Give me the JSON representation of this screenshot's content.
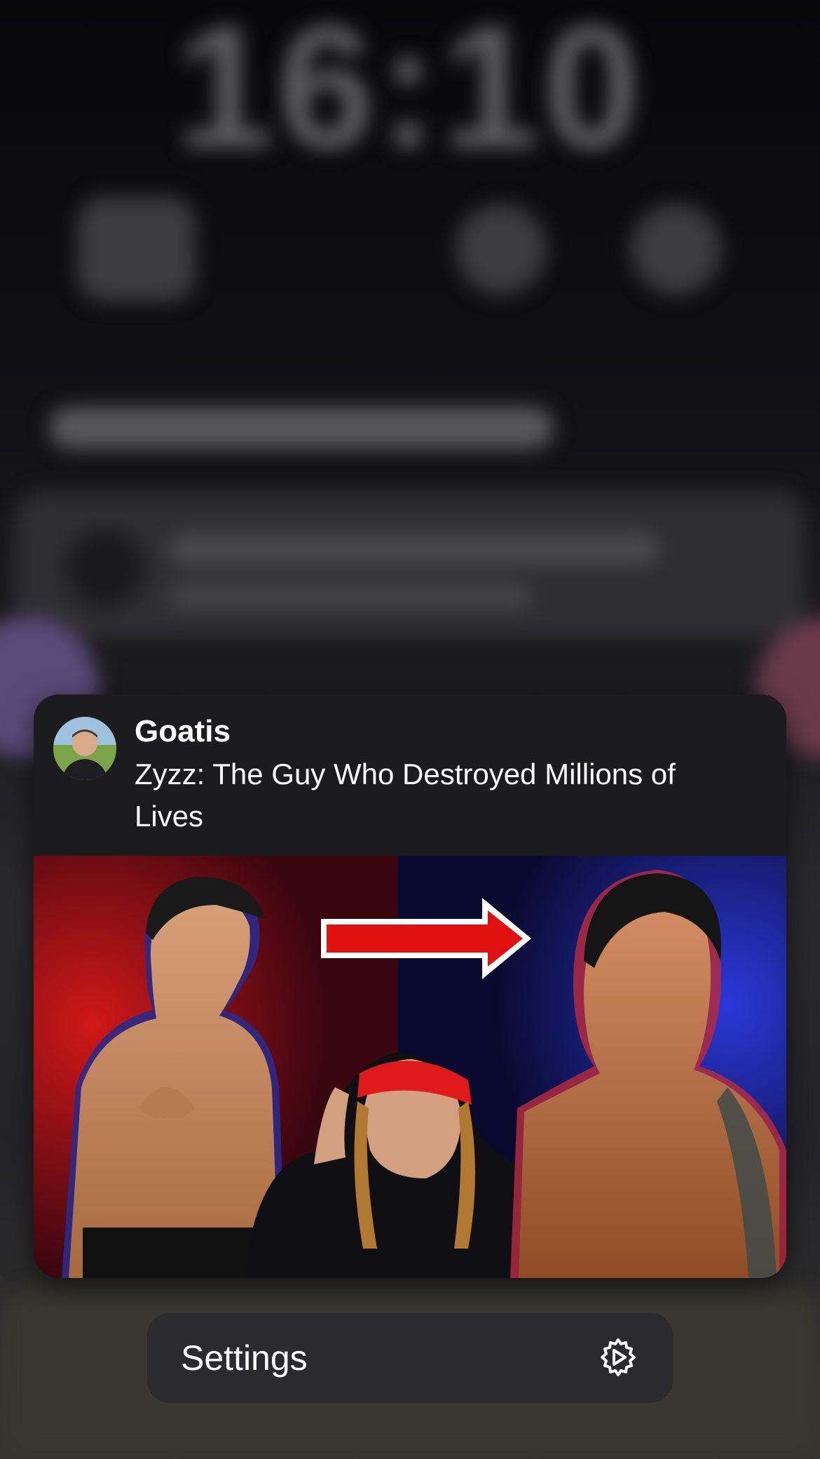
{
  "lock_screen": {
    "time": "16:10"
  },
  "notification": {
    "sender": "Goatis",
    "title": "Zyzz: The Guy Who Destroyed Millions of Lives",
    "avatar_icon": "channel-avatar",
    "thumbnail_icon": "video-thumbnail"
  },
  "actions": {
    "settings_label": "Settings",
    "settings_icon": "gear-play-icon"
  },
  "colors": {
    "card_bg": "#1c1c1e",
    "action_bg": "#2b2b2e",
    "text": "#ffffff"
  }
}
